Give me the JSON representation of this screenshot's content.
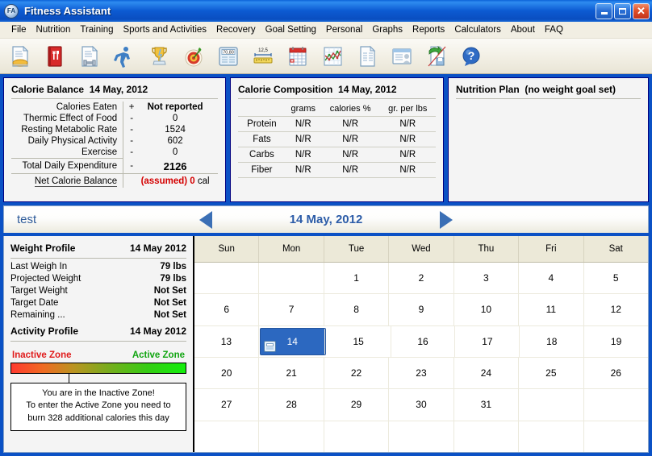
{
  "window": {
    "title": "Fitness Assistant",
    "icon": "FA",
    "buttons": {
      "minimize": "minimize-button",
      "maximize": "maximize-button",
      "close": "close-button"
    }
  },
  "menu": {
    "items": [
      "File",
      "Nutrition",
      "Training",
      "Sports and Activities",
      "Recovery",
      "Goal Setting",
      "Personal",
      "Graphs",
      "Reports",
      "Calculators",
      "About",
      "FAQ"
    ]
  },
  "toolbar": {
    "buttons": [
      {
        "name": "food-diary-icon",
        "title": "Food Diary"
      },
      {
        "name": "food-database-icon",
        "title": "Food Database"
      },
      {
        "name": "training-diary-icon",
        "title": "Training Diary"
      },
      {
        "name": "activity-icon",
        "title": "Activities"
      },
      {
        "name": "trophy-icon",
        "title": "Achievements"
      },
      {
        "name": "target-icon",
        "title": "Goals"
      },
      {
        "name": "weight-scale-icon",
        "title": "Weight",
        "display": "70,80"
      },
      {
        "name": "measure-tape-icon",
        "title": "Measurements",
        "display": "12,5"
      },
      {
        "name": "calendar-icon",
        "title": "Calendar"
      },
      {
        "name": "graph-icon",
        "title": "Graphs"
      },
      {
        "name": "report-icon",
        "title": "Reports"
      },
      {
        "name": "profile-card-icon",
        "title": "Personal Profile"
      },
      {
        "name": "export-save-icon",
        "title": "Export / Save"
      },
      {
        "name": "help-icon",
        "title": "Help"
      }
    ]
  },
  "calorie_balance": {
    "title": "Calorie Balance",
    "date": "14 May, 2012",
    "rows": [
      {
        "label": "Calories Eaten",
        "sign": "+",
        "value": "Not reported",
        "bold": true
      },
      {
        "label": "Thermic Effect of Food",
        "sign": "-",
        "value": "0",
        "bold": false
      },
      {
        "label": "Resting Metabolic Rate",
        "sign": "-",
        "value": "1524",
        "bold": false
      },
      {
        "label": "Daily Physical Activity",
        "sign": "-",
        "value": "602",
        "bold": false
      },
      {
        "label": "Exercise",
        "sign": "-",
        "value": "0",
        "bold": false
      }
    ],
    "total": {
      "label": "Total Daily Expenditure",
      "sign": "-",
      "value": "2126"
    },
    "net": {
      "label": "Net Calorie Balance",
      "assumed": "(assumed) 0",
      "unit": "cal"
    }
  },
  "calorie_composition": {
    "title": "Calorie Composition",
    "date": "14 May, 2012",
    "columns": [
      "",
      "grams",
      "calories %",
      "gr. per lbs"
    ],
    "rows": [
      {
        "name": "Protein",
        "values": [
          "N/R",
          "N/R",
          "N/R"
        ]
      },
      {
        "name": "Fats",
        "values": [
          "N/R",
          "N/R",
          "N/R"
        ]
      },
      {
        "name": "Carbs",
        "values": [
          "N/R",
          "N/R",
          "N/R"
        ]
      },
      {
        "name": "Fiber",
        "values": [
          "N/R",
          "N/R",
          "N/R"
        ]
      }
    ]
  },
  "nutrition_plan": {
    "title": "Nutrition Plan",
    "status": "(no weight goal set)"
  },
  "datebar": {
    "profile_name": "test",
    "current_date": "14 May, 2012",
    "prev_label": "previous-day",
    "next_label": "next-day"
  },
  "weight_profile": {
    "title": "Weight Profile",
    "date": "14 May 2012",
    "rows": [
      {
        "label": "Last Weigh In",
        "value": "79 lbs"
      },
      {
        "label": "Projected Weight",
        "value": "79 lbs"
      },
      {
        "label": "Target Weight",
        "value": "Not Set"
      },
      {
        "label": "Target Date",
        "value": "Not Set"
      },
      {
        "label": "Remaining ...",
        "value": "Not Set"
      }
    ]
  },
  "activity_profile": {
    "title": "Activity Profile",
    "date": "14 May 2012",
    "zone_left_label": "Inactive Zone",
    "zone_right_label": "Active Zone",
    "marker_percent": 33,
    "message_lines": [
      "You are in the Inactive Zone!",
      "To enter the Active Zone you need to",
      "burn 328 additional calories this day"
    ],
    "colors": {
      "inactive": "#e01b1b",
      "active": "#11a511"
    }
  },
  "calendar": {
    "weekday_headers": [
      "Sun",
      "Mon",
      "Tue",
      "Wed",
      "Thu",
      "Fri",
      "Sat"
    ],
    "selected_day": 14,
    "selected_icon": "weight-scale-icon",
    "weeks": [
      [
        "",
        "",
        "1",
        "2",
        "3",
        "4",
        "5"
      ],
      [
        "6",
        "7",
        "8",
        "9",
        "10",
        "11",
        "12"
      ],
      [
        "13",
        "14",
        "15",
        "16",
        "17",
        "18",
        "19"
      ],
      [
        "20",
        "21",
        "22",
        "23",
        "24",
        "25",
        "26"
      ],
      [
        "27",
        "28",
        "29",
        "30",
        "31",
        "",
        ""
      ],
      [
        "",
        "",
        "",
        "",
        "",
        "",
        ""
      ]
    ],
    "selection_color": "#2c68c0"
  }
}
